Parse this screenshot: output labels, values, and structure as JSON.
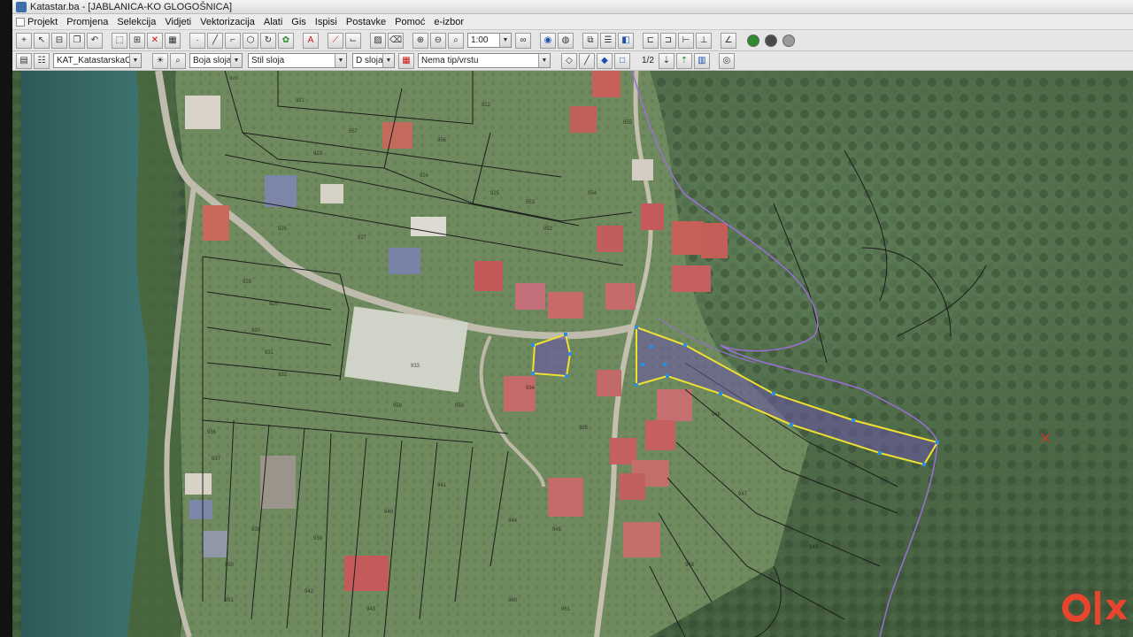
{
  "window": {
    "title": "Katastar.ba - [JABLANICA-KO GLOGOŠNICA]"
  },
  "menu": [
    {
      "label": "Projekt"
    },
    {
      "label": "Promjena"
    },
    {
      "label": "Selekcija"
    },
    {
      "label": "Vidjeti"
    },
    {
      "label": "Vektorizacija"
    },
    {
      "label": "Alati"
    },
    {
      "label": "Gis"
    },
    {
      "label": "Ispisi"
    },
    {
      "label": "Postavke"
    },
    {
      "label": "Pomoć"
    },
    {
      "label": "e-izbor"
    }
  ],
  "toolbar1": {
    "zoom_value": "1:00"
  },
  "toolbar2": {
    "layer_combo": "KAT_KatastarskaOpcina",
    "color_combo": "Boja sloja",
    "style_combo": "Stil sloja",
    "d_sloja_combo": "D sloja",
    "type_combo": "Nema tip/vrstu",
    "scale_label": "1/2"
  },
  "parcel_numbers": [
    "920",
    "921",
    "922",
    "923",
    "924",
    "925",
    "926",
    "927",
    "928",
    "929",
    "930",
    "931",
    "932",
    "933",
    "934",
    "935",
    "936",
    "937",
    "938",
    "939",
    "940",
    "941",
    "942",
    "943",
    "944",
    "945",
    "946",
    "947",
    "948",
    "949",
    "950",
    "951",
    "952",
    "953",
    "954",
    "955",
    "956",
    "957",
    "958",
    "959",
    "960",
    "961"
  ],
  "colors": {
    "selection_outline": "#f0e030",
    "selection_fill": "#6a55a8",
    "vertex": "#2a8fe0",
    "boundary": "#9b6fd8",
    "parcel_line": "#1a1a1a"
  },
  "icons": [
    "move-icon",
    "select-icon",
    "measure-icon",
    "undo-icon",
    "zoom-in-icon",
    "zoom-out-icon",
    "zoom-window-icon",
    "binoculars-icon",
    "globe-icon",
    "layers-icon",
    "print-icon",
    "info-icon"
  ],
  "watermark": "olx"
}
